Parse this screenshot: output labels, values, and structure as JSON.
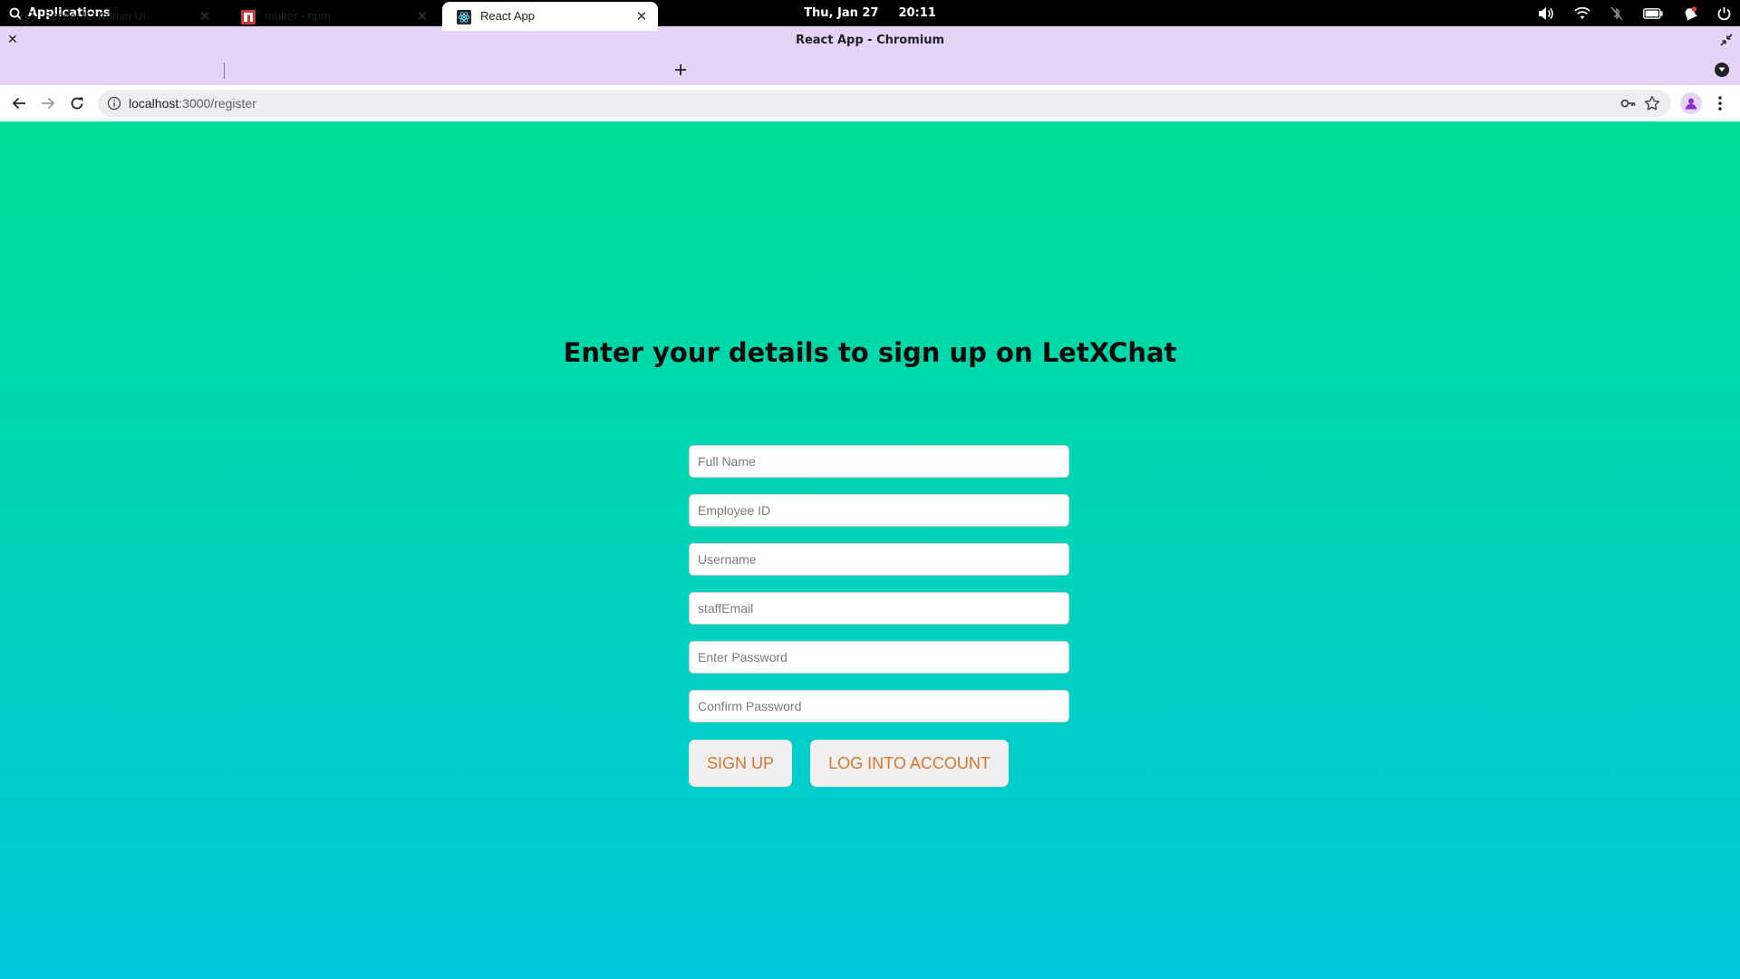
{
  "system_bar": {
    "apps_label": "Applications",
    "date": "Thu, Jan 27",
    "time": "20:11"
  },
  "window": {
    "title": "React App - Chromium"
  },
  "tabs": [
    {
      "label": "Socket.IO Admin UI",
      "icon": "socketio-icon",
      "active": false
    },
    {
      "label": "multer - npm",
      "icon": "npm-icon",
      "active": false
    },
    {
      "label": "React App",
      "icon": "react-icon",
      "active": true
    }
  ],
  "address_bar": {
    "host": "localhost",
    "path": ":3000/register"
  },
  "form": {
    "heading": "Enter your details to sign up on LetXChat",
    "fields": [
      {
        "placeholder": "Full Name",
        "value": ""
      },
      {
        "placeholder": "Employee ID",
        "value": ""
      },
      {
        "placeholder": "Username",
        "value": ""
      },
      {
        "placeholder": "staffEmail",
        "value": ""
      },
      {
        "placeholder": "Enter Password",
        "value": ""
      },
      {
        "placeholder": "Confirm Password",
        "value": ""
      }
    ],
    "signup_label": "SIGN UP",
    "login_label": "LOG INTO ACCOUNT"
  },
  "colors": {
    "gradient_top": "#00dd97",
    "gradient_bottom": "#00c8dc",
    "button_text": "#d9762c",
    "tabstrip": "#e6d4f8"
  }
}
